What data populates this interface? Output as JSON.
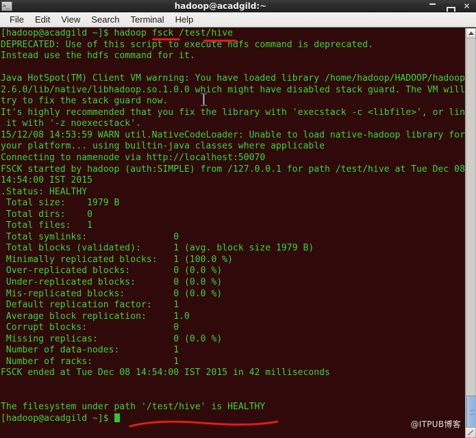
{
  "window": {
    "title": "hadoop@acadgild:~",
    "icon": "terminal-icon",
    "buttons": {
      "minimize": "minimize-button",
      "maximize": "maximize-button",
      "close_label": "✕"
    }
  },
  "menubar": {
    "items": [
      {
        "label": "File",
        "name": "menu-file"
      },
      {
        "label": "Edit",
        "name": "menu-edit"
      },
      {
        "label": "View",
        "name": "menu-view"
      },
      {
        "label": "Search",
        "name": "menu-search"
      },
      {
        "label": "Terminal",
        "name": "menu-terminal"
      },
      {
        "label": "Help",
        "name": "menu-help"
      }
    ]
  },
  "terminal": {
    "background_color": "#300a0a",
    "text_color": "#3ad43a",
    "prompt": "[hadoop@acadgild ~]$ ",
    "command": "hadoop fsck /test/hive",
    "lines": [
      "[hadoop@acadgild ~]$ hadoop fsck /test/hive",
      "DEPRECATED: Use of this script to execute hdfs command is deprecated.",
      "Instead use the hdfs command for it.",
      "",
      "Java HotSpot(TM) Client VM warning: You have loaded library /home/hadoop/HADOOP/hadoop",
      "2.6.0/lib/native/libhadoop.so.1.0.0 which might have disabled stack guard. The VM will",
      "try to fix the stack guard now.",
      "It's highly recommended that you fix the library with 'execstack -c <libfile>', or lin",
      " it with '-z noexecstack'.",
      "15/12/08 14:53:59 WARN util.NativeCodeLoader: Unable to load native-hadoop library for",
      "your platform... using builtin-java classes where applicable",
      "Connecting to namenode via http://localhost:50070",
      "FSCK started by hadoop (auth:SIMPLE) from /127.0.0.1 for path /test/hive at Tue Dec 08",
      "14:54:00 IST 2015",
      ".Status: HEALTHY",
      " Total size:    1979 B",
      " Total dirs:    0",
      " Total files:   1",
      " Total symlinks:                0",
      " Total blocks (validated):      1 (avg. block size 1979 B)",
      " Minimally replicated blocks:   1 (100.0 %)",
      " Over-replicated blocks:        0 (0.0 %)",
      " Under-replicated blocks:       0 (0.0 %)",
      " Mis-replicated blocks:         0 (0.0 %)",
      " Default replication factor:    1",
      " Average block replication:     1.0",
      " Corrupt blocks:                0",
      " Missing replicas:              0 (0.0 %)",
      " Number of data-nodes:          1",
      " Number of racks:               1",
      "FSCK ended at Tue Dec 08 14:54:00 IST 2015 in 42 milliseconds",
      "",
      "",
      "The filesystem under path '/test/hive' is HEALTHY"
    ],
    "final_prompt": "[hadoop@acadgild ~]$ ",
    "fsck_report": {
      "status": "HEALTHY",
      "total_size": "1979 B",
      "total_dirs": "0",
      "total_files": "1",
      "total_symlinks": "0",
      "total_blocks_validated": "1 (avg. block size 1979 B)",
      "minimally_replicated_blocks": "1 (100.0 %)",
      "over_replicated_blocks": "0 (0.0 %)",
      "under_replicated_blocks": "0 (0.0 %)",
      "mis_replicated_blocks": "0 (0.0 %)",
      "default_replication_factor": "1",
      "average_block_replication": "1.0",
      "corrupt_blocks": "0",
      "missing_replicas": "0 (0.0 %)",
      "number_of_data_nodes": "1",
      "number_of_racks": "1",
      "started_at": "Tue Dec 08 14:54:00 IST 2015",
      "ended_at": "Tue Dec 08 14:54:00 IST 2015",
      "duration": "42 milliseconds",
      "namenode_url": "http://localhost:50070",
      "path": "/test/hive"
    }
  },
  "annotations": {
    "color": "#e21b1b",
    "underline_fsck": "fsck",
    "underline_hive": "/hive",
    "underline_healthy": "'/test/hive' is HEALTHY"
  },
  "watermark": {
    "text": "@ITPUB博客"
  },
  "scrollbar": {
    "up_arrow": "scroll-up-arrow",
    "down_arrow": "scroll-down-arrow",
    "thumb": "scroll-thumb"
  }
}
